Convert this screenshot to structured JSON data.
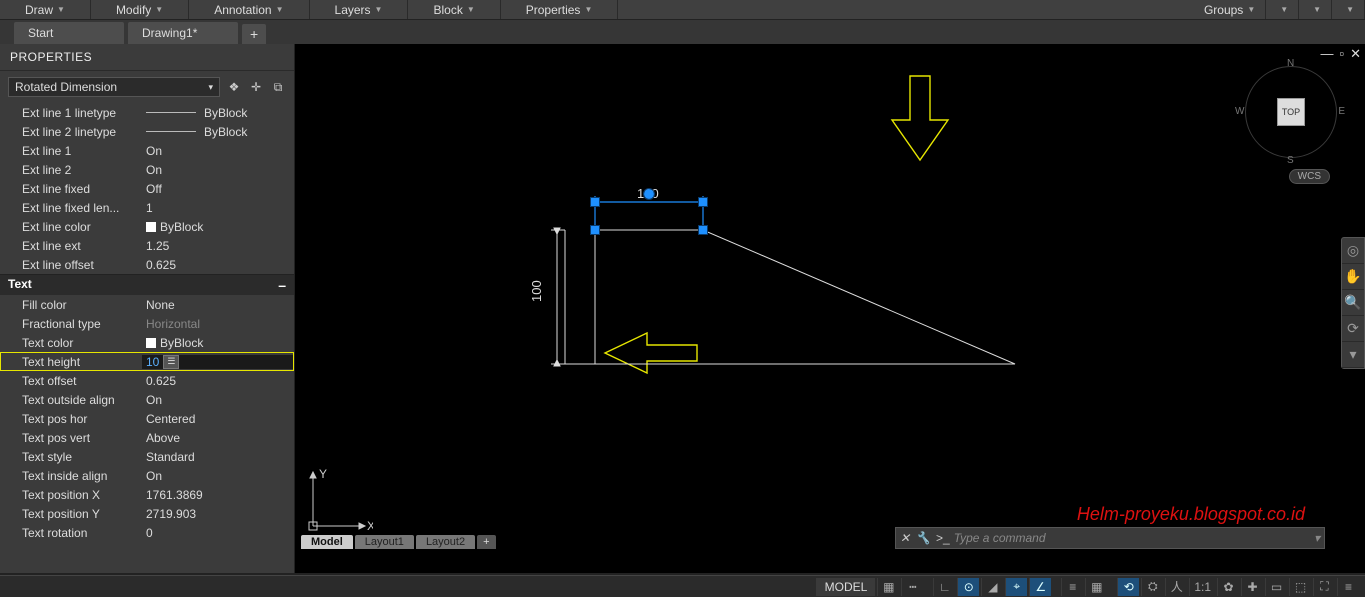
{
  "ribbon": {
    "panels": [
      "Draw",
      "Modify",
      "Annotation",
      "Layers",
      "Block",
      "Properties",
      "Groups"
    ]
  },
  "tabs": {
    "start": "Start",
    "drawing": "Drawing1*",
    "add": "+"
  },
  "palette": {
    "title": "PROPERTIES",
    "object_type": "Rotated Dimension",
    "categories": {
      "lines_rows": [
        {
          "label": "Ext line 1 linetype",
          "value": "ByBlock",
          "linetype": true
        },
        {
          "label": "Ext line 2 linetype",
          "value": "ByBlock",
          "linetype": true
        },
        {
          "label": "Ext line 1",
          "value": "On"
        },
        {
          "label": "Ext line 2",
          "value": "On"
        },
        {
          "label": "Ext line fixed",
          "value": "Off"
        },
        {
          "label": "Ext line fixed len...",
          "value": "1"
        },
        {
          "label": "Ext line color",
          "value": "ByBlock",
          "swatch": true
        },
        {
          "label": "Ext line ext",
          "value": "1.25"
        },
        {
          "label": "Ext line offset",
          "value": "0.625"
        }
      ],
      "text_cat": "Text",
      "text_rows": [
        {
          "label": "Fill color",
          "value": "None"
        },
        {
          "label": "Fractional type",
          "value": "Horizontal",
          "dim": true
        },
        {
          "label": "Text color",
          "value": "ByBlock",
          "swatch": true
        },
        {
          "label": "Text height",
          "value": "10",
          "editing": true
        },
        {
          "label": "Text offset",
          "value": "0.625"
        },
        {
          "label": "Text outside align",
          "value": "On"
        },
        {
          "label": "Text pos hor",
          "value": "Centered"
        },
        {
          "label": "Text pos vert",
          "value": "Above"
        },
        {
          "label": "Text style",
          "value": "Standard"
        },
        {
          "label": "Text inside align",
          "value": "On"
        },
        {
          "label": "Text position X",
          "value": "1761.3869"
        },
        {
          "label": "Text position Y",
          "value": "2719.903"
        },
        {
          "label": "Text rotation",
          "value": "0"
        }
      ]
    }
  },
  "viewport": {
    "dim_h": "100",
    "dim_v": "100",
    "viewcube": {
      "n": "N",
      "e": "E",
      "s": "S",
      "w": "W",
      "top": "TOP",
      "wcs": "WCS"
    },
    "ucs": {
      "x": "X",
      "y": "Y"
    },
    "watermark": "Helm-proyeku.blogspot.co.id",
    "commandline": {
      "placeholder": "Type a command",
      "prompt": ">_"
    }
  },
  "bottom_tabs": {
    "model": "Model",
    "layout1": "Layout1",
    "layout2": "Layout2",
    "add": "+"
  },
  "status": {
    "model": "MODEL",
    "scale": "1:1"
  }
}
